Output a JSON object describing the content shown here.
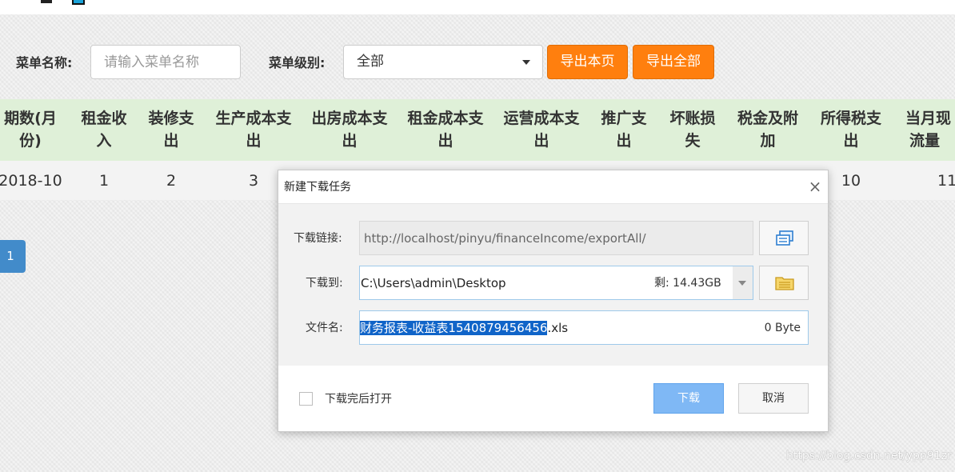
{
  "header": {
    "logo_text": ""
  },
  "filters": {
    "menu_name_label": "菜单名称:",
    "menu_name_placeholder": "请输入菜单名称",
    "menu_level_label": "菜单级别:",
    "menu_level_value": "全部",
    "export_page_label": "导出本页",
    "export_all_label": "导出全部"
  },
  "table": {
    "headers": [
      [
        "期数(月",
        "份)"
      ],
      [
        "租金收",
        "入"
      ],
      [
        "装修支",
        "出"
      ],
      [
        "生产成本支",
        "出"
      ],
      [
        "出房成本支",
        "出"
      ],
      [
        "租金成本支",
        "出"
      ],
      [
        "运营成本支",
        "出"
      ],
      [
        "推广支",
        "出"
      ],
      [
        "坏账损",
        "失"
      ],
      [
        "税金及附",
        "加"
      ],
      [
        "所得税支",
        "出"
      ],
      [
        "当月现",
        "流量"
      ]
    ],
    "row": {
      "period": "2018-10",
      "rent_income": "1",
      "decoration": "2",
      "production": "3",
      "income_tax": "10",
      "cash_flow": "11"
    }
  },
  "pagination": {
    "current": "1"
  },
  "dialog": {
    "title": "新建下载任务",
    "close_glyph": "×",
    "link_label": "下载链接:",
    "link_value": "http://localhost/pinyu/financeIncome/exportAll/",
    "save_to_label": "下载到:",
    "save_to_value": "C:\\Users\\admin\\Desktop",
    "free_space": "剩: 14.43GB",
    "filename_label": "文件名:",
    "filename_selected": "财务报表-收益表1540879456456",
    "filename_ext": ".xls",
    "file_size": "0 Byte",
    "open_after_label": "下载完后打开",
    "download_label": "下载",
    "cancel_label": "取消",
    "icons": {
      "link": "copy-icon",
      "folder": "folder-icon"
    },
    "colors": {
      "primary": "#7fb8f5",
      "selection": "#1064c8"
    }
  },
  "colors": {
    "accent_orange": "#ff7f0e",
    "table_header_bg": "#dff0d8",
    "page_button": "#428bca"
  },
  "watermark": "https://blog.csdn.net/ypp91zr"
}
